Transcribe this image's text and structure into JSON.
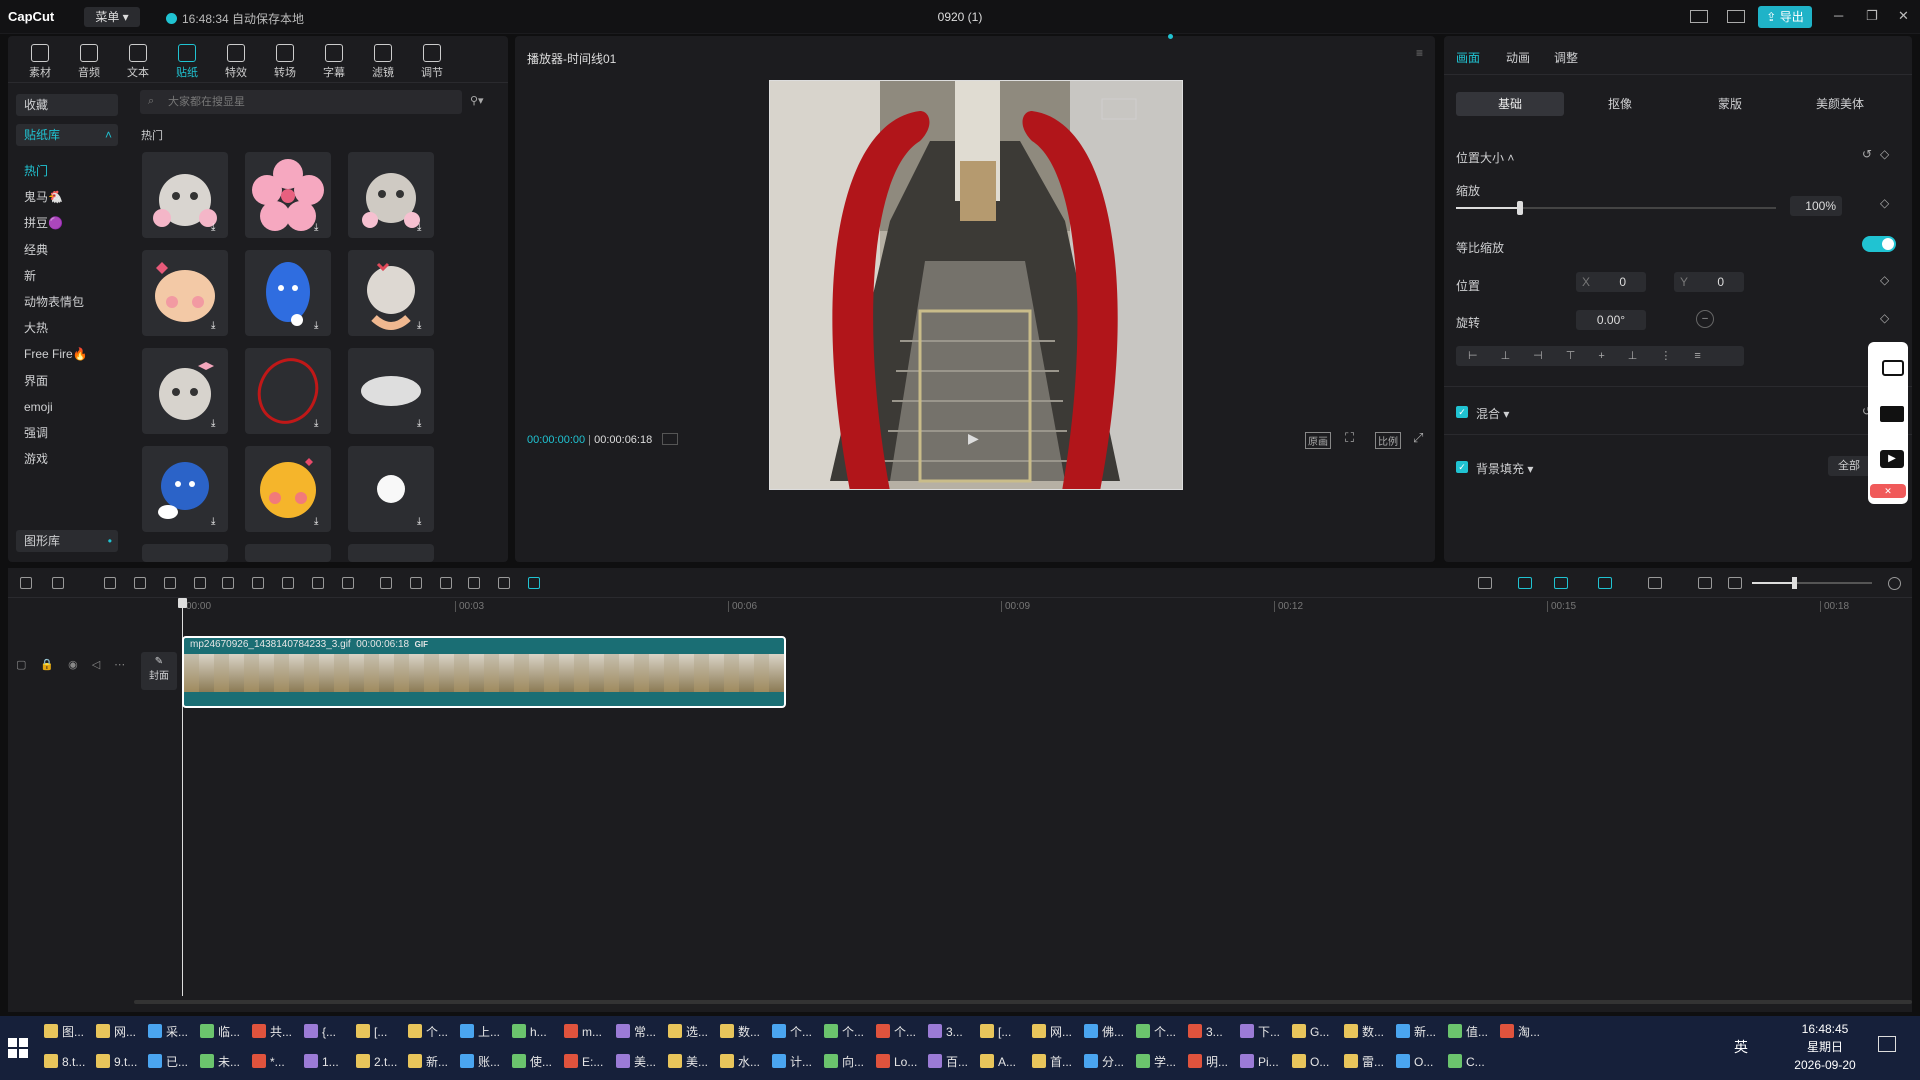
{
  "titlebar": {
    "app_name": "CapCut",
    "menu_label": "菜单",
    "save_status": "16:48:34 自动保存本地",
    "document_title": "0920 (1)",
    "export_label": "导出"
  },
  "toolbar": {
    "items": [
      {
        "label": "素材",
        "icon": "media-icon"
      },
      {
        "label": "音频",
        "icon": "audio-icon"
      },
      {
        "label": "文本",
        "icon": "text-icon"
      },
      {
        "label": "贴纸",
        "icon": "sticker-icon"
      },
      {
        "label": "特效",
        "icon": "effects-icon"
      },
      {
        "label": "转场",
        "icon": "transition-icon"
      },
      {
        "label": "字幕",
        "icon": "caption-icon"
      },
      {
        "label": "滤镜",
        "icon": "filter-icon"
      },
      {
        "label": "调节",
        "icon": "adjust-icon"
      }
    ],
    "active": "贴纸"
  },
  "sidebar": {
    "favorites": "收藏",
    "library": "贴纸库",
    "categories": [
      "热门",
      "鬼马🐔",
      "拼豆🟣",
      "经典",
      "新",
      "动物表情包",
      "大热",
      "Free Fire🔥",
      "界面",
      "emoji",
      "强调",
      "游戏"
    ],
    "active_category": "热门",
    "shape_library": "图形库"
  },
  "stickers": {
    "search_placeholder": "大家都在搜显星",
    "section_title": "热门",
    "items": [
      "cat-flowers",
      "pink-blossom",
      "cat-flowers-2",
      "blushing-cat",
      "blue-sad-face",
      "cat-heart-hands",
      "cat-bow",
      "red-circle",
      "white-cloud",
      "blue-sad-emoji",
      "blush-emoji",
      "white-dot"
    ]
  },
  "player": {
    "title": "播放器-时间线01",
    "current_time": "00:00:00:00",
    "total_time": "00:00:06:18",
    "btn_original": "原画",
    "btn_ratio": "比例"
  },
  "inspector": {
    "tabs": [
      "画面",
      "动画",
      "调整"
    ],
    "active_tab": "画面",
    "subtabs": [
      "基础",
      "抠像",
      "蒙版",
      "美颜美体"
    ],
    "active_subtab": "基础",
    "section_position_size": "位置大小",
    "scale_label": "缩放",
    "scale_value": "100%",
    "scale_fraction": 0.2,
    "uniform_scale_label": "等比缩放",
    "uniform_scale_on": true,
    "position_label": "位置",
    "x_label": "X",
    "x_value": "0",
    "y_label": "Y",
    "y_value": "0",
    "rotation_label": "旋转",
    "rotation_value": "0.00°",
    "blend_label": "混合",
    "bg_fill_label": "背景填充",
    "apply_all": "全部"
  },
  "timeline": {
    "ticks": [
      "00:00",
      "00:03",
      "00:06",
      "00:09",
      "00:12",
      "00:15",
      "00:18"
    ],
    "cover_label": "封面",
    "clip_name": "mp24670926_1438140784233_3.gif",
    "clip_duration": "00:00:06:18",
    "clip_badge": "GIF"
  },
  "taskbar": {
    "row1": [
      "图...",
      "网...",
      "采...",
      "临...",
      "共...",
      "{...",
      "[...",
      "个...",
      "上...",
      "h...",
      "m...",
      "常...",
      "选...",
      "数...",
      "个...",
      "个...",
      "个...",
      "3...",
      "[...",
      "网...",
      "佛...",
      "个...",
      "3...",
      "下...",
      "G...",
      "数...",
      "新...",
      "值...",
      "淘..."
    ],
    "row2": [
      "8.t...",
      "9.t...",
      "已...",
      "未...",
      "*...",
      "1...",
      "2.t...",
      "新...",
      "账...",
      "使...",
      "E:...",
      "美...",
      "美...",
      "水...",
      "计...",
      "向...",
      "Lo...",
      "百...",
      "A...",
      "首...",
      "分...",
      "学...",
      "明...",
      "Pi...",
      "O...",
      "雷...",
      "O...",
      "C..."
    ],
    "ime": "英",
    "clock_time": "16:48:45",
    "clock_day": "星期日",
    "clock_date": "2026-09-20"
  },
  "colors": {
    "accent": "#20c3d2",
    "panel": "#1c1c1f",
    "clip": "#1a6e74",
    "taskbar": "#16203a"
  }
}
